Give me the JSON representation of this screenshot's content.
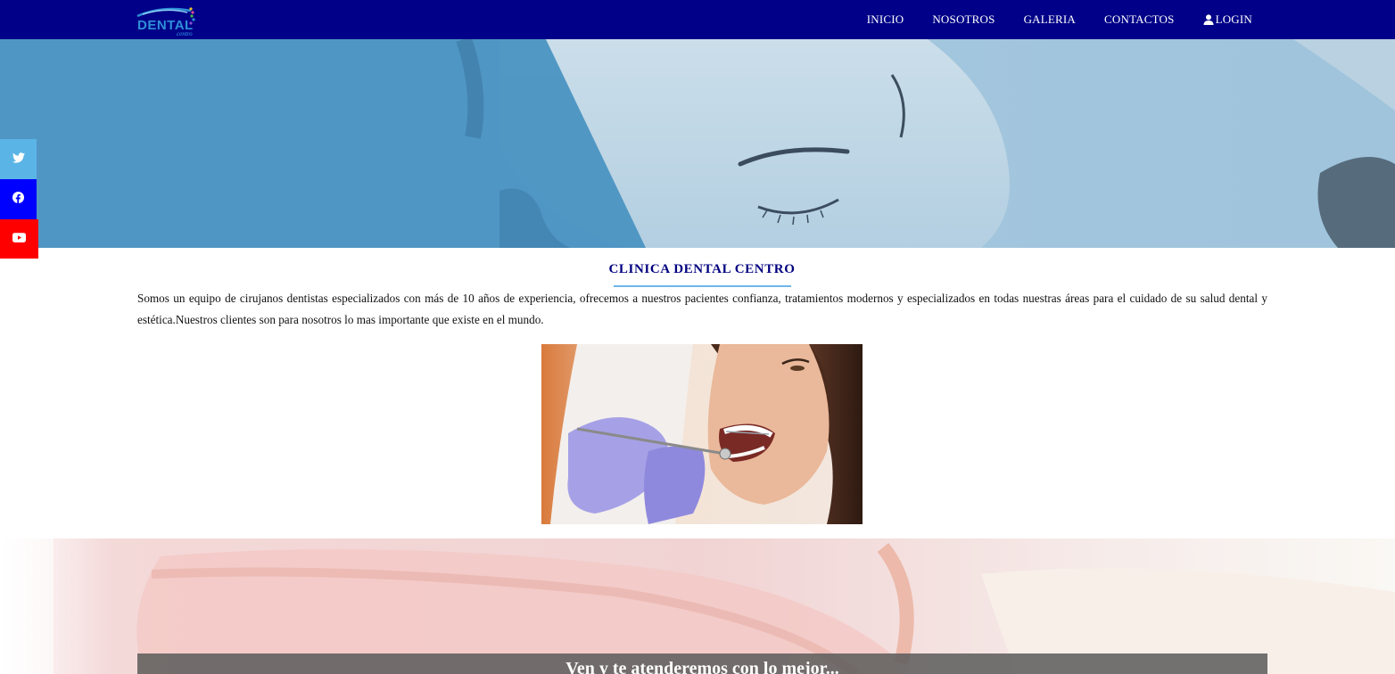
{
  "brand": {
    "logo_text": "DENTAL",
    "logo_sub": "centro"
  },
  "nav": {
    "items": [
      {
        "label": "INICIO"
      },
      {
        "label": "NOSOTROS"
      },
      {
        "label": "GALERIA"
      },
      {
        "label": "CONTACTOS"
      },
      {
        "label": "LOGIN",
        "icon": "user-icon"
      }
    ]
  },
  "social": [
    {
      "name": "twitter-icon",
      "color": "#5bb4e6"
    },
    {
      "name": "facebook-icon",
      "color": "#0000ff"
    },
    {
      "name": "youtube-icon",
      "color": "#ff0000"
    }
  ],
  "about": {
    "title": "CLINICA DENTAL CENTRO",
    "text": "Somos un equipo de cirujanos dentistas especializados con más de 10 años de experiencia, ofrecemos a nuestros pacientes confianza, tratamientos modernos y especializados en todas nuestras áreas para el cuidado de su salud dental y estética.Nuestros clientes son para nosotros lo mas importante que existe en el mundo."
  },
  "banner": {
    "cta": "Ven y te atenderemos con lo mejor..."
  },
  "colors": {
    "navbar": "#000088",
    "title": "#000080",
    "accent_line": "#6fb6e8"
  }
}
